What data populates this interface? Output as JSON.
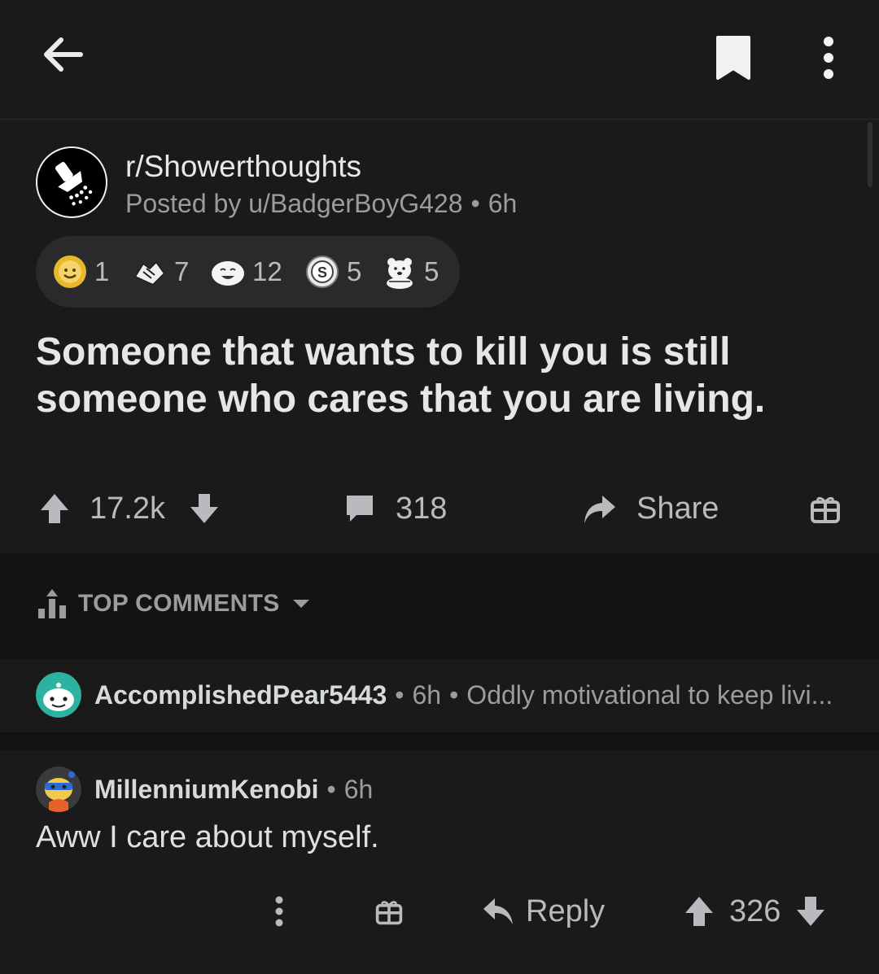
{
  "post": {
    "subreddit": "r/Showerthoughts",
    "posted_by": "Posted by u/BadgerBoyG428",
    "age": "6h",
    "title": "Someone that wants to kill you is still someone who cares that you are living.",
    "awards": [
      {
        "icon": "sun-award-icon",
        "count": "1"
      },
      {
        "icon": "handshake-award-icon",
        "count": "7"
      },
      {
        "icon": "laughing-award-icon",
        "count": "12"
      },
      {
        "icon": "silver-award-icon",
        "count": "5"
      },
      {
        "icon": "bear-award-icon",
        "count": "5"
      }
    ],
    "score": "17.2k",
    "comments_count": "318",
    "share_label": "Share"
  },
  "comments_section": {
    "sort_label": "TOP COMMENTS"
  },
  "collapsed_comment": {
    "user": "AccomplishedPear5443",
    "age": "6h",
    "preview": "Oddly motivational to keep livi..."
  },
  "comment": {
    "user": "MillenniumKenobi",
    "age": "6h",
    "body": "Aww I care about myself.",
    "reply_label": "Reply",
    "score": "326"
  },
  "colors": {
    "background": "#1a1a1b",
    "band": "#131314",
    "text": "#d7dadc",
    "muted": "#9a9c9f"
  }
}
